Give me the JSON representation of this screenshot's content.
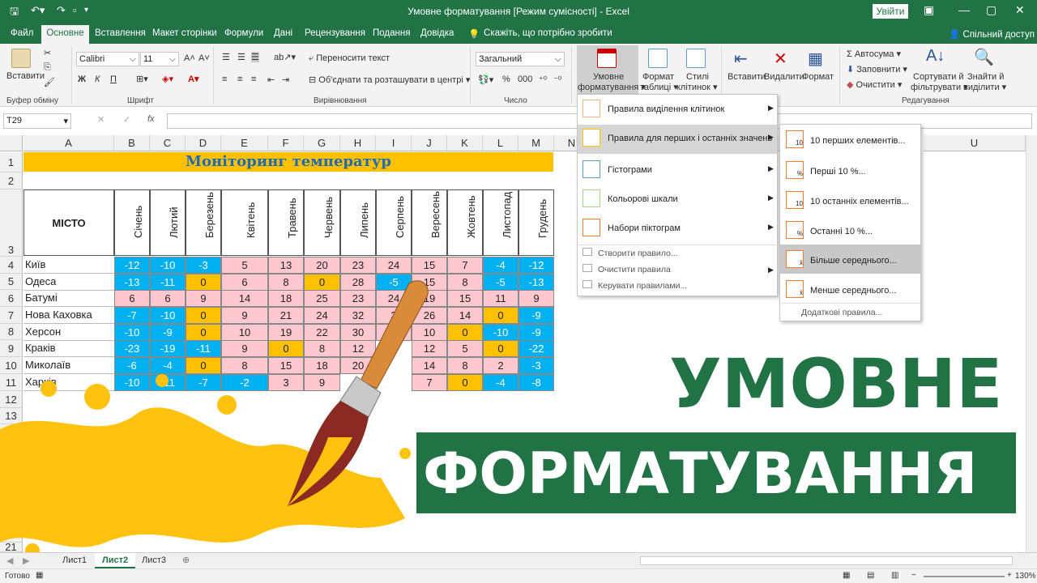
{
  "window": {
    "title": "Умовне форматування  [Режим сумісності]  -  Excel",
    "signin": "Увійти"
  },
  "tabs": [
    {
      "label": "Файл"
    },
    {
      "label": "Основне"
    },
    {
      "label": "Вставлення"
    },
    {
      "label": "Макет сторінки"
    },
    {
      "label": "Формули"
    },
    {
      "label": "Дані"
    },
    {
      "label": "Рецензування"
    },
    {
      "label": "Подання"
    },
    {
      "label": "Довідка"
    }
  ],
  "tellme": "Скажіть, що потрібно зробити",
  "share": "Спільний доступ",
  "ribbon": {
    "paste": "Вставити",
    "font_name": "Calibri",
    "font_size": "11",
    "wrap": "Переносити текст",
    "merge": "Об'єднати та розташувати в центрі",
    "number_format": "Загальний",
    "cond_format_1": "Умовне",
    "cond_format_2": "форматування ▾",
    "format_table_1": "Формат",
    "format_table_2": "таблиці ▾",
    "cell_styles_1": "Стилі",
    "cell_styles_2": "клітинок ▾",
    "insert": "Вставити",
    "delete": "Видалити",
    "format": "Формат",
    "autosum": "Автосума ▾",
    "fill": "Заповнити ▾",
    "clear": "Очистити ▾",
    "sort_1": "Сортувати й",
    "sort_2": "фільтрувати ▾",
    "find_1": "Знайти й",
    "find_2": "виділити ▾",
    "groups": {
      "clipboard": "Буфер обміну",
      "font": "Шрифт",
      "alignment": "Вирівнювання",
      "number": "Число",
      "editing": "Редагування"
    },
    "bold": "Ж",
    "italic": "К",
    "underline": "П"
  },
  "formula_bar": {
    "name_box": "T29",
    "fx": "fx"
  },
  "columns": [
    "A",
    "B",
    "C",
    "D",
    "E",
    "F",
    "G",
    "H",
    "I",
    "J",
    "K",
    "L",
    "M",
    "N",
    "O",
    "P",
    "Q",
    "R",
    "S",
    "T",
    "U"
  ],
  "rows": [
    "1",
    "2",
    "3",
    "4",
    "5",
    "6",
    "7",
    "8",
    "9",
    "10",
    "11",
    "12",
    "13",
    "14",
    "15",
    "16",
    "17",
    "18",
    "19",
    "20",
    "21"
  ],
  "sheet_title": "Моніторинг температур",
  "city_header": "МІСТО",
  "months": [
    "Січень",
    "Лютий",
    "Березень",
    "Квітень",
    "Травень",
    "Червень",
    "Липень",
    "Серпень",
    "Вересень",
    "Жовтень",
    "Листопад",
    "Грудень"
  ],
  "cities": [
    {
      "name": "Київ",
      "values": [
        "-12",
        "-10",
        "-3",
        "5",
        "13",
        "20",
        "23",
        "24",
        "15",
        "7",
        "-4",
        "-12"
      ]
    },
    {
      "name": "Одеса",
      "values": [
        "-13",
        "-11",
        "0",
        "6",
        "8",
        "0",
        "28",
        "-5",
        "15",
        "8",
        "-5",
        "-13"
      ]
    },
    {
      "name": "Батумі",
      "values": [
        "6",
        "6",
        "9",
        "14",
        "18",
        "25",
        "23",
        "24",
        "19",
        "15",
        "11",
        "9"
      ]
    },
    {
      "name": "Нова Каховка",
      "values": [
        "-7",
        "-10",
        "0",
        "9",
        "21",
        "24",
        "32",
        "3",
        "26",
        "14",
        "0",
        "-9"
      ]
    },
    {
      "name": "Херсон",
      "values": [
        "-10",
        "-9",
        "0",
        "10",
        "19",
        "22",
        "30",
        "3",
        "10",
        "0",
        "-10",
        "-9"
      ]
    },
    {
      "name": "Краків",
      "values": [
        "-23",
        "-19",
        "-11",
        "9",
        "0",
        "8",
        "12",
        "",
        "12",
        "5",
        "0",
        "-22"
      ]
    },
    {
      "name": "Миколаїв",
      "values": [
        "-6",
        "-4",
        "0",
        "8",
        "15",
        "18",
        "20",
        "",
        "14",
        "8",
        "2",
        "-3"
      ]
    },
    {
      "name": "Харків",
      "values": [
        "-10",
        "-11",
        "-7",
        "-2",
        "3",
        "9",
        "",
        "",
        "7",
        "0",
        "-4",
        "-8"
      ]
    }
  ],
  "cell_colors": {
    "negative": "#00b0f0",
    "zero": "#ffc000",
    "positive": "#ffc7ce",
    "title": "#ffc000",
    "title_text": "#1f6bb0",
    "brand": "#217346"
  },
  "menu": {
    "items": [
      {
        "label": "Правила виділення клітинок"
      },
      {
        "label": "Правила для перших і останніх значень"
      },
      {
        "label": "Гістограми"
      },
      {
        "label": "Кольорові шкали"
      },
      {
        "label": "Набори піктограм"
      }
    ],
    "small": [
      {
        "label": "Створити правило..."
      },
      {
        "label": "Очистити правила"
      },
      {
        "label": "Керувати правилами..."
      }
    ]
  },
  "submenu": {
    "items": [
      {
        "label": "10 перших елементів..."
      },
      {
        "label": "Перші 10 %..."
      },
      {
        "label": "10 останніх елементів..."
      },
      {
        "label": "Останні 10 %..."
      },
      {
        "label": "Більше середнього..."
      },
      {
        "label": "Менше середнього..."
      }
    ],
    "more": "Додаткові правила...",
    "icon_texts": [
      "10",
      "%",
      "10",
      "%",
      "x̄",
      "x̄"
    ]
  },
  "sheets": [
    {
      "label": "Лист1"
    },
    {
      "label": "Лист2"
    },
    {
      "label": "Лист3"
    }
  ],
  "status": {
    "ready": "Готово",
    "zoom": "130%"
  },
  "overlay": {
    "line1": "УМОВНЕ",
    "line2": "ФОРМАТУВАННЯ"
  }
}
